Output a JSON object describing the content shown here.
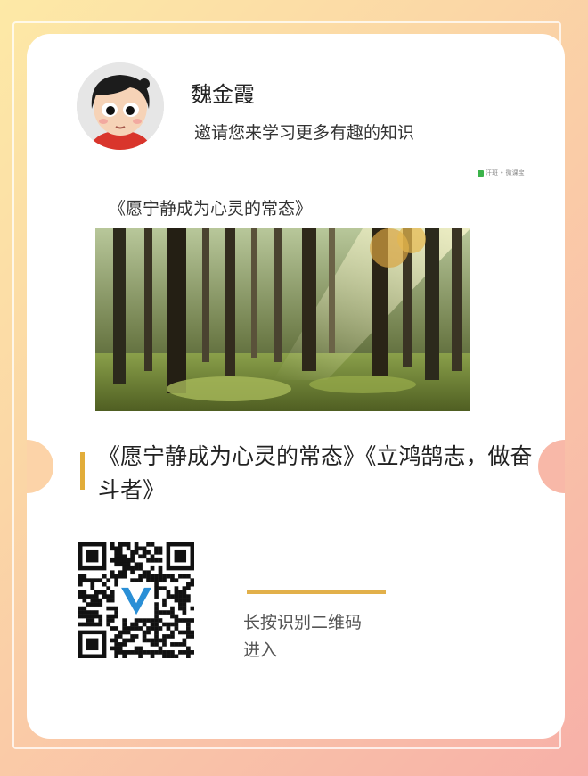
{
  "user": {
    "name": "魏金霞",
    "invite_text": "邀请您来学习更多有趣的知识",
    "avatar_icon": "cartoon-boy-avatar"
  },
  "brand": {
    "label": "汗班 • 微课宝",
    "color": "#3bb34a"
  },
  "course": {
    "title_small": "《愿宁静成为心灵的常态》",
    "title_full": "《愿宁静成为心灵的常态》《立鸿鹄志，做奋斗者》",
    "cover_description_icon": "forest-sunlight-photo"
  },
  "qr": {
    "hint_line1": "长按识别二维码",
    "hint_line2": "进入",
    "logo_icon": "v-logo-icon"
  },
  "colors": {
    "accent_gold": "#e2ad3a",
    "background_start": "#fde9a6",
    "background_end": "#f7b0a8"
  }
}
